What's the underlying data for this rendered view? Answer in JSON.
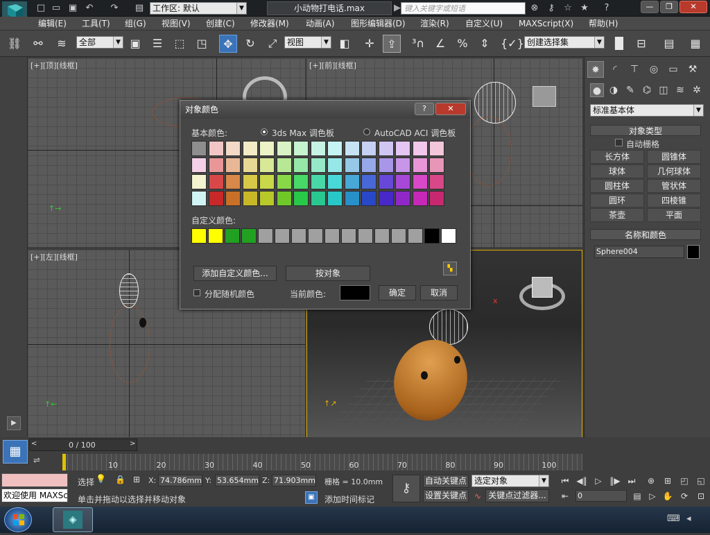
{
  "app": {
    "workspace_label": "工作区: 默认",
    "file_title": "小动物打电话.max",
    "search_placeholder": "键入关键字或短语"
  },
  "menu": [
    "编辑(E)",
    "工具(T)",
    "组(G)",
    "视图(V)",
    "创建(C)",
    "修改器(M)",
    "动画(A)",
    "图形编辑器(D)",
    "渲染(R)",
    "自定义(U)",
    "MAXScript(X)",
    "帮助(H)"
  ],
  "toolbar": {
    "filter_select": "全部",
    "ref_coord": "视图",
    "named_selection": "创建选择集"
  },
  "viewports": {
    "top": "[+][顶][线框]",
    "front": "[+][前][线框]",
    "left": "[+][左][线框]"
  },
  "command_panel": {
    "category_select": "标准基本体",
    "object_type_header": "对象类型",
    "auto_grid": "自动栅格",
    "buttons": [
      "长方体",
      "圆锥体",
      "球体",
      "几何球体",
      "圆柱体",
      "管状体",
      "圆环",
      "四棱锥",
      "茶壶",
      "平面"
    ],
    "name_color_header": "名称和颜色",
    "object_name": "Sphere004",
    "object_color": "#000000"
  },
  "dialog": {
    "title": "对象颜色",
    "help": "?",
    "basic_colors_label": "基本颜色:",
    "palette_3dsmax": "3ds Max 调色板",
    "palette_autocad": "AutoCAD ACI 调色板",
    "custom_colors_label": "自定义颜色:",
    "add_custom_button": "添加自定义颜色...",
    "by_object_button": "按对象",
    "random_colors": "分配随机颜色",
    "current_color_label": "当前颜色:",
    "current_color": "#000000",
    "ok": "确定",
    "cancel": "取消",
    "basic_colors": [
      [
        "#8e8e8e",
        "#f3c6c6",
        "#f3d9c6",
        "#f3ebc6",
        "#ecf3c6",
        "#d9f3c6",
        "#c6f3d0",
        "#c6f3e3",
        "#c6f3f3",
        "#c6e3f3",
        "#c6d0f3",
        "#d0c6f3",
        "#e3c6f3",
        "#f3c6ec",
        "#f3c6d9"
      ],
      [
        "#f3d0e8",
        "#e89696",
        "#e8b896",
        "#e8d896",
        "#d8e896",
        "#b8e896",
        "#96e8a8",
        "#96e8c8",
        "#96e8e8",
        "#96c8e8",
        "#96a8e8",
        "#a896e8",
        "#c896e8",
        "#e896d8",
        "#e896b8"
      ],
      [
        "#f3f3d0",
        "#d84848",
        "#d88848",
        "#d8c848",
        "#c8d848",
        "#88d848",
        "#48d868",
        "#48d8a8",
        "#48d8d8",
        "#48a8d8",
        "#4868d8",
        "#6848d8",
        "#a848d8",
        "#d848c8",
        "#d84888"
      ],
      [
        "#d0f3f3",
        "#c82828",
        "#c87028",
        "#c8b828",
        "#b8c828",
        "#70c828",
        "#28c848",
        "#28c890",
        "#28c8c8",
        "#2890c8",
        "#2848c8",
        "#4828c8",
        "#9028c8",
        "#c828b8",
        "#c82870"
      ]
    ],
    "custom_colors": [
      "#ffff00",
      "#ffff00",
      "#22a022",
      "#22a022",
      "#a0a0a0",
      "#a0a0a0",
      "#a0a0a0",
      "#a0a0a0",
      "#a0a0a0",
      "#a0a0a0",
      "#a0a0a0",
      "#a0a0a0",
      "#a0a0a0",
      "#a0a0a0",
      "#000000",
      "#ffffff"
    ]
  },
  "timeline": {
    "frame_counter": "0 / 100",
    "ticks": [
      "10",
      "20",
      "30",
      "40",
      "50",
      "60",
      "70",
      "80",
      "90",
      "100"
    ]
  },
  "status": {
    "welcome": "欢迎使用 MAXScr",
    "select_label": "选择",
    "x_label": "X:",
    "x_value": "74.786mm",
    "y_label": "Y:",
    "y_value": "53.654mm",
    "z_label": "Z:",
    "z_value": "71.903mm",
    "grid": "栅格 = 10.0mm",
    "prompt": "单击并拖动以选择并移动对象",
    "add_time_tag": "添加时间标记",
    "auto_key": "自动关键点",
    "set_key": "设置关键点",
    "selected_object": "选定对象",
    "key_filters": "关键点过滤器...",
    "frame_field": "0"
  }
}
